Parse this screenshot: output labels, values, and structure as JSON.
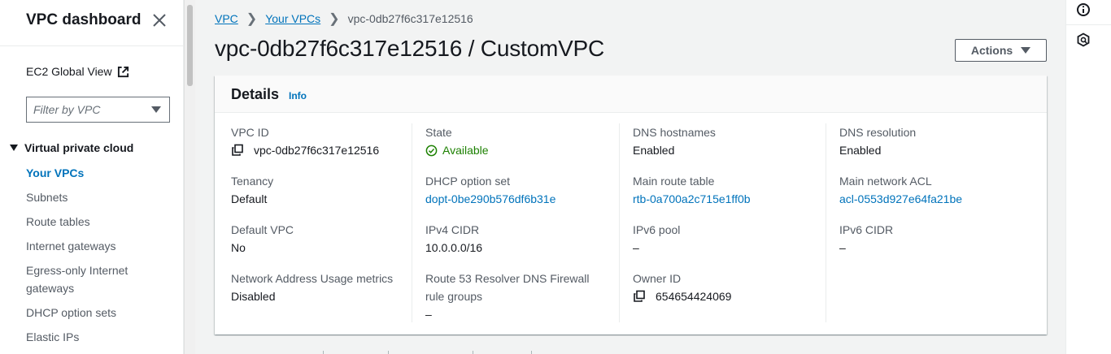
{
  "sidebar": {
    "title": "VPC dashboard",
    "ec2_global_view": "EC2 Global View",
    "filter_placeholder": "Filter by VPC",
    "section": "Virtual private cloud",
    "items": [
      {
        "label": "Your VPCs",
        "active": true
      },
      {
        "label": "Subnets"
      },
      {
        "label": "Route tables"
      },
      {
        "label": "Internet gateways"
      },
      {
        "label": "Egress-only Internet gateways"
      },
      {
        "label": "DHCP option sets"
      },
      {
        "label": "Elastic IPs"
      }
    ]
  },
  "breadcrumb": {
    "items": [
      "VPC",
      "Your VPCs"
    ],
    "current": "vpc-0db27f6c317e12516"
  },
  "page": {
    "title": "vpc-0db27f6c317e12516 / CustomVPC",
    "actions_label": "Actions"
  },
  "details": {
    "title": "Details",
    "info": "Info",
    "columns": [
      [
        {
          "label": "VPC ID",
          "value": "vpc-0db27f6c317e12516",
          "copy": true
        },
        {
          "label": "Tenancy",
          "value": "Default"
        },
        {
          "label": "Default VPC",
          "value": "No"
        },
        {
          "label": "Network Address Usage metrics",
          "value": "Disabled"
        }
      ],
      [
        {
          "label": "State",
          "value": "Available",
          "status": "ok"
        },
        {
          "label": "DHCP option set",
          "value": "dopt-0be290b576df6b31e",
          "link": true
        },
        {
          "label": "IPv4 CIDR",
          "value": "10.0.0.0/16"
        },
        {
          "label": "Route 53 Resolver DNS Firewall rule groups",
          "value": "–"
        }
      ],
      [
        {
          "label": "DNS hostnames",
          "value": "Enabled"
        },
        {
          "label": "Main route table",
          "value": "rtb-0a700a2c715e1ff0b",
          "link": true
        },
        {
          "label": "IPv6 pool",
          "value": "–"
        },
        {
          "label": "Owner ID",
          "value": "654654424069",
          "copy": true
        }
      ],
      [
        {
          "label": "DNS resolution",
          "value": "Enabled"
        },
        {
          "label": "Main network ACL",
          "value": "acl-0553d927e64fa21be",
          "link": true
        },
        {
          "label": "IPv6 CIDR",
          "value": "–"
        }
      ]
    ]
  },
  "colors": {
    "link": "#0073bb",
    "success": "#1d8102",
    "text": "#16191f",
    "label": "#545b64"
  }
}
